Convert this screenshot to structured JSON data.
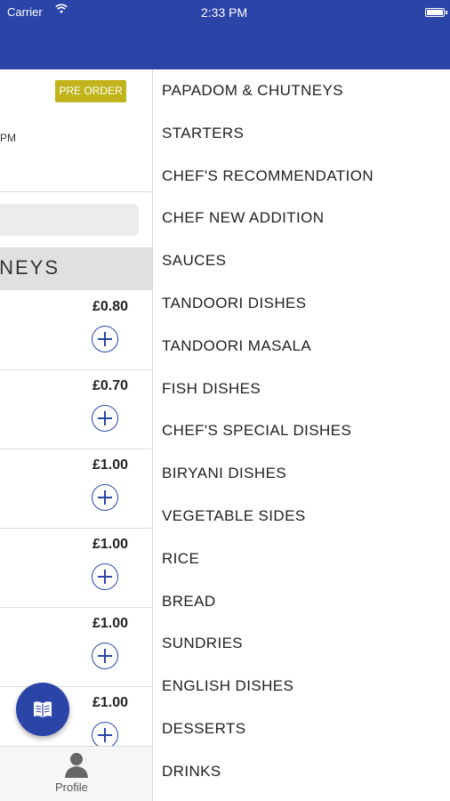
{
  "status_bar": {
    "carrier": "Carrier",
    "time": "2:33 PM"
  },
  "left_panel": {
    "preorder_label": "PRE ORDER",
    "time_fragment": "PM",
    "category_title": "NEYS",
    "items": [
      {
        "price": "£0.80"
      },
      {
        "price": "£0.70"
      },
      {
        "price": "£1.00"
      },
      {
        "price": "£1.00"
      },
      {
        "price": "£1.00"
      },
      {
        "price": "£1.00"
      }
    ],
    "bottom_nav": {
      "profile_label": "Profile"
    }
  },
  "menu_categories": [
    "PAPADOM & CHUTNEYS",
    "STARTERS",
    "CHEF'S RECOMMENDATION",
    "CHEF NEW ADDITION",
    "SAUCES",
    "TANDOORI DISHES",
    "TANDOORI MASALA",
    "FISH DISHES",
    "CHEF'S SPECIAL DISHES",
    "BIRYANI DISHES",
    "VEGETABLE SIDES",
    "RICE",
    "BREAD",
    "SUNDRIES",
    "ENGLISH DISHES",
    "DESSERTS",
    "DRINKS"
  ],
  "colors": {
    "primary": "#2b44a8",
    "preorder_badge": "#c0b41a"
  }
}
